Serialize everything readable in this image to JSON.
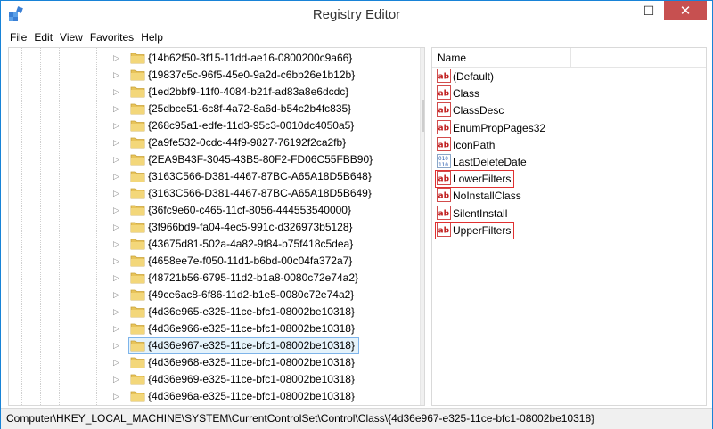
{
  "window": {
    "title": "Registry Editor",
    "minimize_glyph": "—",
    "maximize_glyph": "☐",
    "close_glyph": "✕",
    "accent_color": "#1883d7",
    "close_color": "#c75050"
  },
  "menu": [
    "File",
    "Edit",
    "View",
    "Favorites",
    "Help"
  ],
  "tree": {
    "items": [
      {
        "label": "{14b62f50-3f15-11dd-ae16-0800200c9a66}"
      },
      {
        "label": "{19837c5c-96f5-45e0-9a2d-c6bb26e1b12b}"
      },
      {
        "label": "{1ed2bbf9-11f0-4084-b21f-ad83a8e6dcdc}"
      },
      {
        "label": "{25dbce51-6c8f-4a72-8a6d-b54c2b4fc835}"
      },
      {
        "label": "{268c95a1-edfe-11d3-95c3-0010dc4050a5}"
      },
      {
        "label": "{2a9fe532-0cdc-44f9-9827-76192f2ca2fb}"
      },
      {
        "label": "{2EA9B43F-3045-43B5-80F2-FD06C55FBB90}"
      },
      {
        "label": "{3163C566-D381-4467-87BC-A65A18D5B648}"
      },
      {
        "label": "{3163C566-D381-4467-87BC-A65A18D5B649}"
      },
      {
        "label": "{36fc9e60-c465-11cf-8056-444553540000}"
      },
      {
        "label": "{3f966bd9-fa04-4ec5-991c-d326973b5128}"
      },
      {
        "label": "{43675d81-502a-4a82-9f84-b75f418c5dea}"
      },
      {
        "label": "{4658ee7e-f050-11d1-b6bd-00c04fa372a7}"
      },
      {
        "label": "{48721b56-6795-11d2-b1a8-0080c72e74a2}"
      },
      {
        "label": "{49ce6ac8-6f86-11d2-b1e5-0080c72e74a2}"
      },
      {
        "label": "{4d36e965-e325-11ce-bfc1-08002be10318}"
      },
      {
        "label": "{4d36e966-e325-11ce-bfc1-08002be10318}"
      },
      {
        "label": "{4d36e967-e325-11ce-bfc1-08002be10318}",
        "selected": true
      },
      {
        "label": "{4d36e968-e325-11ce-bfc1-08002be10318}"
      },
      {
        "label": "{4d36e969-e325-11ce-bfc1-08002be10318}"
      },
      {
        "label": "{4d36e96a-e325-11ce-bfc1-08002be10318}"
      }
    ],
    "expand_glyph": "▷",
    "folder_color": "#e8c45a"
  },
  "values": {
    "column_name": "Name",
    "items": [
      {
        "label": "(Default)",
        "type": "string-value-icon"
      },
      {
        "label": "Class",
        "type": "string-value-icon"
      },
      {
        "label": "ClassDesc",
        "type": "string-value-icon"
      },
      {
        "label": "EnumPropPages32",
        "type": "string-value-icon"
      },
      {
        "label": "IconPath",
        "type": "string-value-icon"
      },
      {
        "label": "LastDeleteDate",
        "type": "binary-value-icon"
      },
      {
        "label": "LowerFilters",
        "type": "string-value-icon",
        "highlight": true
      },
      {
        "label": "NoInstallClass",
        "type": "string-value-icon"
      },
      {
        "label": "SilentInstall",
        "type": "string-value-icon"
      },
      {
        "label": "UpperFilters",
        "type": "string-value-icon",
        "highlight": true
      }
    ],
    "highlight_color": "#e03030"
  },
  "status": {
    "path": "Computer\\HKEY_LOCAL_MACHINE\\SYSTEM\\CurrentControlSet\\Control\\Class\\{4d36e967-e325-11ce-bfc1-08002be10318}"
  },
  "scrollbar": {
    "up_glyph": "▲",
    "down_glyph": "▼"
  }
}
